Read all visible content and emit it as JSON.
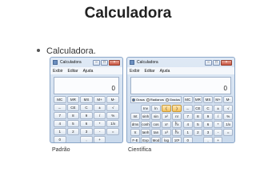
{
  "slide": {
    "title": "Calculadora",
    "bullet": "Calculadora.",
    "label_standard": "Padrão",
    "label_scientific": "Científica"
  },
  "standard": {
    "window_title": "Calculadora",
    "menu": [
      "Exibir",
      "Editar",
      "Ajuda"
    ],
    "display": "0",
    "rows": [
      [
        "MC",
        "MR",
        "MS",
        "M+",
        "M-"
      ],
      [
        "←",
        "CE",
        "C",
        "±",
        "√"
      ],
      [
        "7",
        "8",
        "9",
        "/",
        "%"
      ],
      [
        "4",
        "5",
        "6",
        "*",
        "1/x"
      ],
      [
        "1",
        "2",
        "3",
        "-",
        "="
      ],
      [
        "0",
        "",
        ",",
        "+",
        ""
      ]
    ]
  },
  "scientific": {
    "window_title": "Calculadora",
    "menu": [
      "Exibir",
      "Editar",
      "Ajuda"
    ],
    "display": "0",
    "angle_modes": [
      "Graus",
      "Radianos",
      "Grados"
    ],
    "selected_mode": "Graus",
    "mem_keys": [
      "MC",
      "MR",
      "MS",
      "M+",
      "M-"
    ],
    "sci_rows": [
      [
        "",
        "Inv",
        "ln",
        "(",
        ")"
      ],
      [
        "Int",
        "sinh",
        "sin",
        "x²",
        "n!"
      ],
      [
        "dms",
        "cosh",
        "cos",
        "xʸ",
        "∛x"
      ],
      [
        "π",
        "tanh",
        "tan",
        "x³",
        "∛x"
      ],
      [
        "F-E",
        "Exp",
        "Mod",
        "log",
        "10ˣ"
      ]
    ],
    "num_rows": [
      [
        "←",
        "CE",
        "C",
        "±",
        "√"
      ],
      [
        "7",
        "8",
        "9",
        "/",
        "%"
      ],
      [
        "4",
        "5",
        "6",
        "*",
        "1/x"
      ],
      [
        "1",
        "2",
        "3",
        "-",
        "="
      ],
      [
        "0",
        "",
        ",",
        "+",
        ""
      ]
    ]
  }
}
